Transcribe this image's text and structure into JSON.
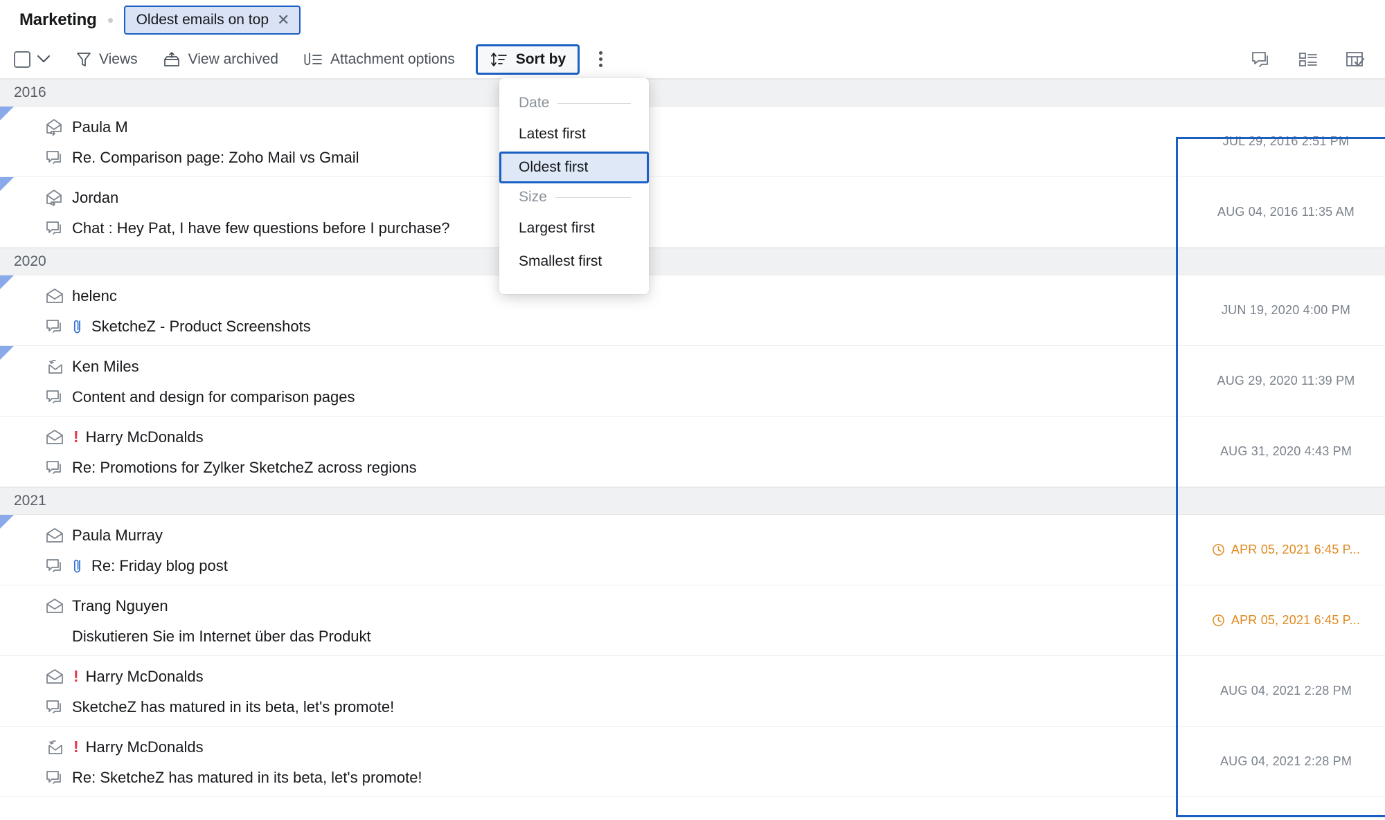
{
  "header": {
    "folder_title": "Marketing",
    "sort_chip": {
      "label": "Oldest emails on top",
      "close_icon": "close-icon"
    }
  },
  "toolbar": {
    "select_all_checkbox": "select-all-checkbox",
    "select_dropdown_icon": "chevron-down-icon",
    "items": [
      {
        "label": "Views",
        "icon": "funnel-icon"
      },
      {
        "label": "View archived",
        "icon": "archive-icon"
      },
      {
        "label": "Attachment options",
        "icon": "attachment-list-icon"
      }
    ],
    "sort_by": {
      "label": "Sort by",
      "icon": "sort-icon"
    },
    "more_options_icon": "kebab-menu-icon",
    "right_icons": [
      {
        "name": "conversation-view-icon"
      },
      {
        "name": "list-view-icon"
      },
      {
        "name": "table-view-icon"
      }
    ]
  },
  "sort_menu": {
    "sections": [
      {
        "title": "Date",
        "options": [
          {
            "label": "Latest first",
            "selected": false
          },
          {
            "label": "Oldest first",
            "selected": true
          }
        ]
      },
      {
        "title": "Size",
        "options": [
          {
            "label": "Largest first",
            "selected": false
          },
          {
            "label": "Smallest first",
            "selected": false
          }
        ]
      }
    ]
  },
  "colors": {
    "accent_blue": "#1a5fc4",
    "chip_bg": "#d9e3f5",
    "selected_bg": "#dee8f7",
    "priority_red": "#e8334a",
    "scheduled_orange": "#e08a1e",
    "flag_blue": "#8aa9ea",
    "year_band_bg": "#f0f1f3"
  },
  "list": {
    "groups": [
      {
        "year": "2016",
        "rows": [
          {
            "sender": "Paula M",
            "subject": "Re. Comparison page: Zoho Mail vs Gmail",
            "date": "JUL 29, 2016 2:51 PM",
            "sender_icon": "envelope-replied-icon",
            "subject_icon": "conversation-icon",
            "attachment": false,
            "priority": false,
            "flagged": true,
            "scheduled": false
          },
          {
            "sender": "Jordan",
            "subject": "Chat : Hey Pat, I have few questions before I purchase?",
            "date": "AUG 04, 2016 11:35 AM",
            "sender_icon": "envelope-replied-icon",
            "subject_icon": "conversation-icon",
            "attachment": false,
            "priority": false,
            "flagged": true,
            "scheduled": false
          }
        ]
      },
      {
        "year": "2020",
        "rows": [
          {
            "sender": "helenc",
            "subject": "SketcheZ - Product Screenshots",
            "date": "JUN 19, 2020 4:00 PM",
            "sender_icon": "envelope-open-icon",
            "subject_icon": "conversation-icon",
            "attachment": true,
            "priority": false,
            "flagged": true,
            "scheduled": false
          },
          {
            "sender": "Ken Miles",
            "subject": "Content and design for comparison pages",
            "date": "AUG 29, 2020 11:39 PM",
            "sender_icon": "envelope-reply-arrow-icon",
            "subject_icon": "conversation-icon",
            "attachment": false,
            "priority": false,
            "flagged": true,
            "scheduled": false
          },
          {
            "sender": "Harry McDonalds",
            "subject": "Re: Promotions for Zylker SketcheZ across regions",
            "date": "AUG 31, 2020 4:43 PM",
            "sender_icon": "envelope-open-icon",
            "subject_icon": "conversation-icon",
            "attachment": false,
            "priority": true,
            "flagged": false,
            "scheduled": false
          }
        ]
      },
      {
        "year": "2021",
        "rows": [
          {
            "sender": "Paula Murray",
            "subject": "Re: Friday blog post",
            "date": "APR 05, 2021 6:45 P...",
            "sender_icon": "envelope-open-icon",
            "subject_icon": "conversation-icon",
            "attachment": true,
            "priority": false,
            "flagged": true,
            "scheduled": true
          },
          {
            "sender": "Trang Nguyen",
            "subject": "Diskutieren Sie im Internet über das Produkt",
            "date": "APR 05, 2021 6:45 P...",
            "sender_icon": "envelope-open-icon",
            "subject_icon": null,
            "attachment": false,
            "priority": false,
            "flagged": false,
            "scheduled": true
          },
          {
            "sender": "Harry McDonalds",
            "subject": "SketcheZ has matured in its beta, let's promote!",
            "date": "AUG 04, 2021 2:28 PM",
            "sender_icon": "envelope-open-icon",
            "subject_icon": "conversation-icon",
            "attachment": false,
            "priority": true,
            "flagged": false,
            "scheduled": false
          },
          {
            "sender": "Harry McDonalds",
            "subject": "Re: SketcheZ has matured in its beta, let's promote!",
            "date": "AUG 04, 2021 2:28 PM",
            "sender_icon": "envelope-reply-arrow-icon",
            "subject_icon": "conversation-icon",
            "attachment": false,
            "priority": true,
            "flagged": false,
            "scheduled": false
          }
        ]
      }
    ]
  }
}
